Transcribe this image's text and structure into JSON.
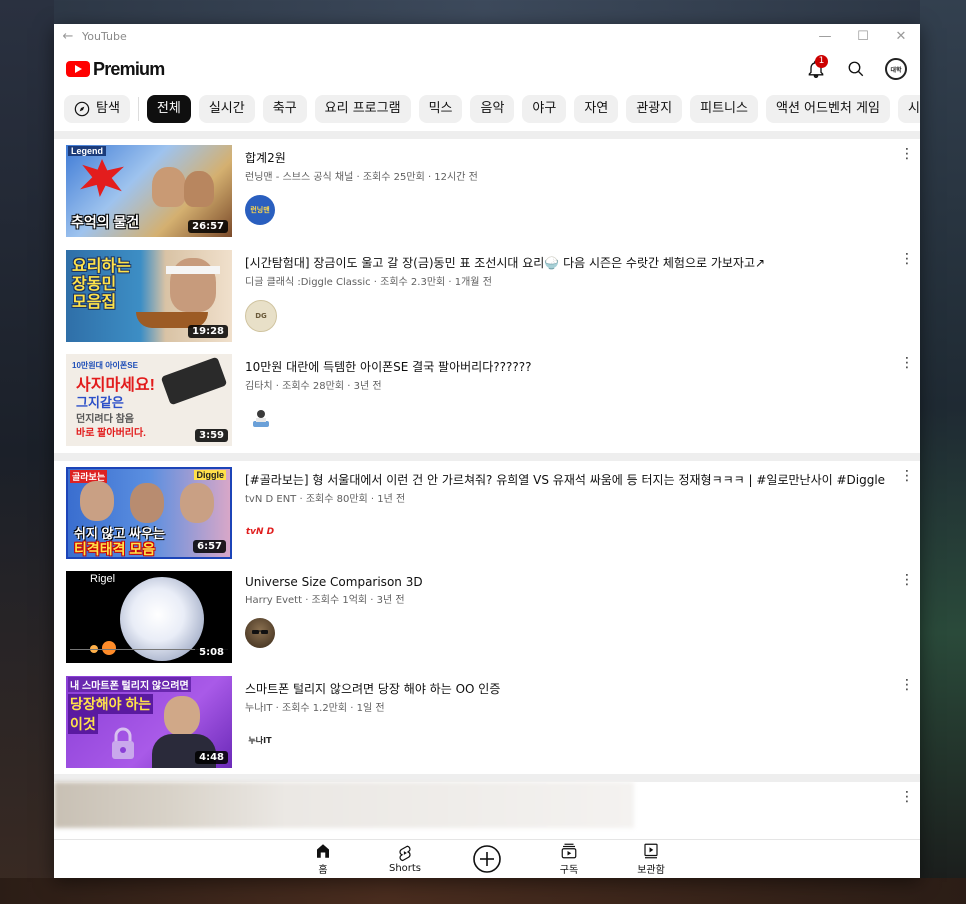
{
  "window": {
    "title": "YouTube",
    "back_icon": "←",
    "minimize": "—",
    "maximize": "☐",
    "close": "✕"
  },
  "header": {
    "logo_text": "Premium",
    "notification_count": "1",
    "avatar_text": "대학"
  },
  "chips": {
    "explore": "탐색",
    "items": [
      "전체",
      "실시간",
      "축구",
      "요리 프로그램",
      "믹스",
      "음악",
      "야구",
      "자연",
      "관광지",
      "피트니스",
      "액션 어드벤처 게임",
      "시각"
    ]
  },
  "videos": [
    {
      "title": "합계2원",
      "meta": "런닝맨 - 스브스 공식 채널 · 조회수 25만회 · 12시간 전",
      "duration": "26:57",
      "thumb_top": "Legend",
      "thumb_caption": "추억의 물건",
      "avatar_text": "런닝맨",
      "avatar_color": "#2a5fbf"
    },
    {
      "title": "[시간탐험대] 장금이도 울고 갈 장(금)동민 표 조선시대 요리🍚 다음 시즌은 수랏간 체험으로 가보자고↗",
      "meta": "디글 클래식 :Diggle Classic · 조회수 2.3만회 · 1개월 전",
      "duration": "19:28",
      "thumb_caption": "요리하는 장동민 모음집",
      "avatar_text": "DG",
      "avatar_color": "#e8e0c8"
    },
    {
      "title": "10만원 대란에 득템한  아이폰SE 결국 팔아버리다??????",
      "meta": "김타치 · 조회수 28만회 · 3년 전",
      "duration": "3:59",
      "thumb_line1": "10만원대 아이폰SE",
      "thumb_line2": "사지마세요!",
      "thumb_line3": "그지같은",
      "thumb_line4": "던지려다 참음",
      "thumb_line5": "바로 팔아버리다.",
      "avatar_text": "",
      "avatar_color": "#ffffff"
    },
    {
      "title": "[#골라보는] 형 서울대에서 이런 건 안 가르쳐줘? 유희열 VS 유재석 싸움에 등 터지는 정재형ㅋㅋㅋ | #일로만난사이 #Diggle",
      "meta": "tvN D ENT · 조회수 80만회 · 1년 전",
      "duration": "6:57",
      "thumb_top": "골라보는",
      "thumb_tag": "Diggle",
      "thumb_caption": "티격태격 모음",
      "thumb_caption2": "쉬지 않고 싸우는",
      "avatar_text": "tvN D",
      "avatar_color": "#ffffff"
    },
    {
      "title": "Universe Size Comparison 3D",
      "meta": "Harry Evett · 조회수 1억회 · 3년 전",
      "duration": "5:08",
      "thumb_top": "Rigel",
      "avatar_text": "",
      "avatar_color": "#5a4a3a"
    },
    {
      "title": "스마트폰 털리지 않으려면 당장 해야 하는 OO 인증",
      "meta": "누나IT · 조회수 1.2만회 · 1일 전",
      "duration": "4:48",
      "thumb_line1": "내 스마트폰 털리지 않으려면",
      "thumb_line2": "당장해야 하는",
      "thumb_line3": "이것",
      "avatar_text": "누나IT",
      "avatar_color": "#ffffff"
    }
  ],
  "more_icon": "⋮",
  "bottom_nav": [
    {
      "label": "홈",
      "icon": "home-icon"
    },
    {
      "label": "Shorts",
      "icon": "shorts-icon"
    },
    {
      "label": "",
      "icon": "create-icon"
    },
    {
      "label": "구독",
      "icon": "subscriptions-icon"
    },
    {
      "label": "보관함",
      "icon": "library-icon"
    }
  ],
  "colors": {
    "brand_red": "#ff0000",
    "chip_active_bg": "#0f0f0f",
    "chip_bg": "#f0f0f0",
    "meta_text": "#606060"
  }
}
